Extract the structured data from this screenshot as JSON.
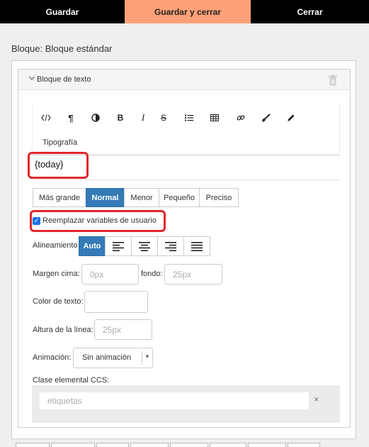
{
  "topbar": {
    "save_label": "Guardar",
    "save_close_label": "Guardar y cerrar",
    "close_label": "Cerrar",
    "accent": "#ffa177"
  },
  "block": {
    "title": "Bloque: Bloque estándar",
    "panel_label": "Bloque de texto"
  },
  "toolbar": {
    "icons": [
      "code-icon",
      "paragraph-icon",
      "contrast-icon",
      "bold-icon",
      "italic-icon",
      "strikethrough-icon",
      "list-icon",
      "table-icon",
      "link-icon",
      "brush-icon",
      "pencil-icon"
    ],
    "typography_label": "Tipografía"
  },
  "editor": {
    "content": "{today}"
  },
  "sizes": {
    "options": [
      "Más grande",
      "Normal",
      "Menor",
      "Pequeño",
      "Preciso"
    ],
    "selected": "Normal"
  },
  "replace_vars": {
    "label": "Reemplazar variables de usuario",
    "checked": true
  },
  "alignment": {
    "label": "Alineamiento",
    "auto_label": "Auto",
    "options": [
      "Auto",
      "left",
      "center",
      "right",
      "justify"
    ]
  },
  "margins": {
    "top_label": "Margen cima:",
    "top_placeholder": "0px",
    "bottom_label": "fondo:",
    "bottom_placeholder": "25px"
  },
  "text_color": {
    "label": "Color de texto:"
  },
  "line_height": {
    "label": "Altura de la línea:",
    "placeholder": "25px"
  },
  "animation": {
    "label": "Animación:",
    "selected": "Sin animación"
  },
  "css_class": {
    "label": "Clase elemental CCS:",
    "placeholder": "etiquetas",
    "clear_glyph": "×"
  },
  "highlight_color": "#e0262c",
  "primary_color": "#337ab7"
}
